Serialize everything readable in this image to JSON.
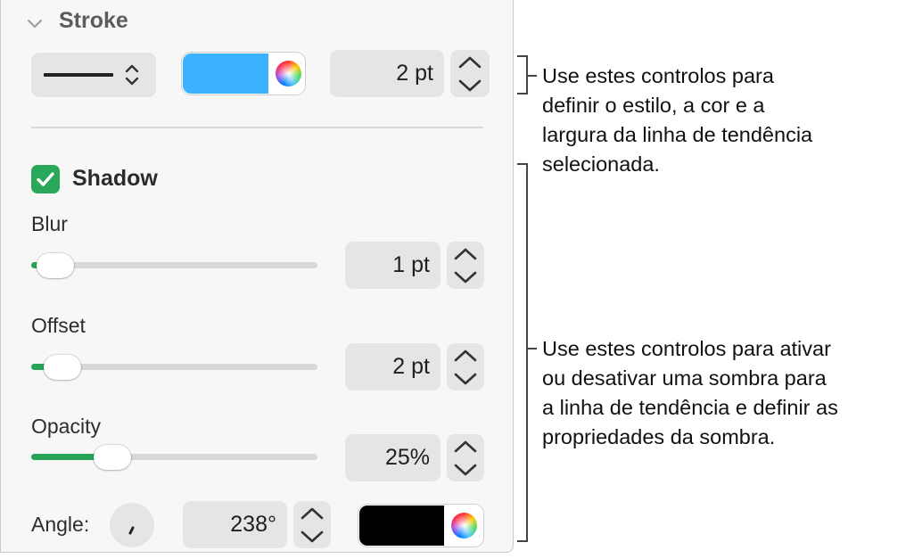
{
  "stroke": {
    "title": "Stroke",
    "style_select": "solid-line",
    "color_hex": "#3ab2ff",
    "width_value": "2 pt"
  },
  "shadow": {
    "title": "Shadow",
    "enabled": true,
    "blur": {
      "label": "Blur",
      "value": "1 pt",
      "slider_fraction": 0.02
    },
    "offset": {
      "label": "Offset",
      "value": "2 pt",
      "slider_fraction": 0.05
    },
    "opacity": {
      "label": "Opacity",
      "value": "25%",
      "slider_fraction": 0.25
    },
    "angle": {
      "label": "Angle:",
      "value": "238°"
    },
    "color_hex": "#000000"
  },
  "callouts": {
    "stroke": [
      "Use estes controlos para",
      "definir o estilo, a cor e a",
      "largura da linha de tendência",
      "selecionada."
    ],
    "shadow": [
      "Use estes controlos para ativar",
      "ou desativar uma sombra para",
      "a linha de tendência e definir as",
      "propriedades da sombra."
    ]
  },
  "colors": {
    "accent": "#27a356",
    "panel_bg": "#f7f7f7",
    "control_bg": "#e5e5e5"
  }
}
